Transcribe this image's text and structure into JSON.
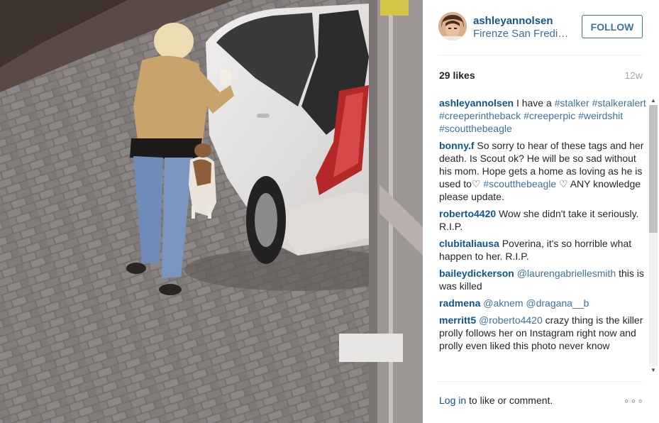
{
  "post": {
    "username": "ashleyannolsen",
    "location": "Firenze San Frediano",
    "follow_label": "FOLLOW",
    "likes": "29 likes",
    "timestamp": "12w"
  },
  "comments": [
    {
      "author": "ashleyannolsen",
      "parts": [
        {
          "t": "I have a "
        },
        {
          "t": "#stalker",
          "tag": true
        },
        {
          "t": " "
        },
        {
          "t": "#stalkeralert",
          "tag": true
        },
        {
          "t": " "
        },
        {
          "t": "#creeperintheback",
          "tag": true
        },
        {
          "t": " "
        },
        {
          "t": "#creeperpic",
          "tag": true
        },
        {
          "t": " "
        },
        {
          "t": "#weirdshit",
          "tag": true
        },
        {
          "t": " "
        },
        {
          "t": "#scoutthebeagle",
          "tag": true
        }
      ]
    },
    {
      "author": "bonny.f",
      "parts": [
        {
          "t": "So sorry to hear of these tags and her death. Is Scout ok? He will be so sad without his mom. Hope gets a home as loving as he is used to♡ "
        },
        {
          "t": "#scoutthebeagle",
          "tag": true
        },
        {
          "t": " ♡ ANY knowledge please update."
        }
      ]
    },
    {
      "author": "roberto4420",
      "parts": [
        {
          "t": "Wow she didn't take it seriously. R.I.P."
        }
      ]
    },
    {
      "author": "clubitaliausa",
      "parts": [
        {
          "t": "Poverina, it's so horrible what happen to her. R.I.P."
        }
      ]
    },
    {
      "author": "baileydickerson",
      "parts": [
        {
          "t": "@laurengabriellesmith",
          "tag": true
        },
        {
          "t": " this is was killed"
        }
      ]
    },
    {
      "author": "radmena",
      "parts": [
        {
          "t": "@aknem",
          "tag": true
        },
        {
          "t": " "
        },
        {
          "t": "@dragana__b",
          "tag": true
        }
      ]
    },
    {
      "author": "merritt5",
      "parts": [
        {
          "t": "@roberto4420",
          "tag": true
        },
        {
          "t": " crazy thing is the killer prolly follows her on Instagram right now and prolly even liked this photo never know"
        }
      ]
    }
  ],
  "footer": {
    "login_link": "Log in",
    "login_rest": " to like or comment.",
    "more_label": "∘∘∘"
  },
  "scroll": {
    "up_arrow": "▲",
    "down_arrow": "▼"
  },
  "colors": {
    "username_link": "#125688",
    "hashtag_link": "#3f729b",
    "follow_border": "#3f729b",
    "muted": "#a5a7aa"
  }
}
